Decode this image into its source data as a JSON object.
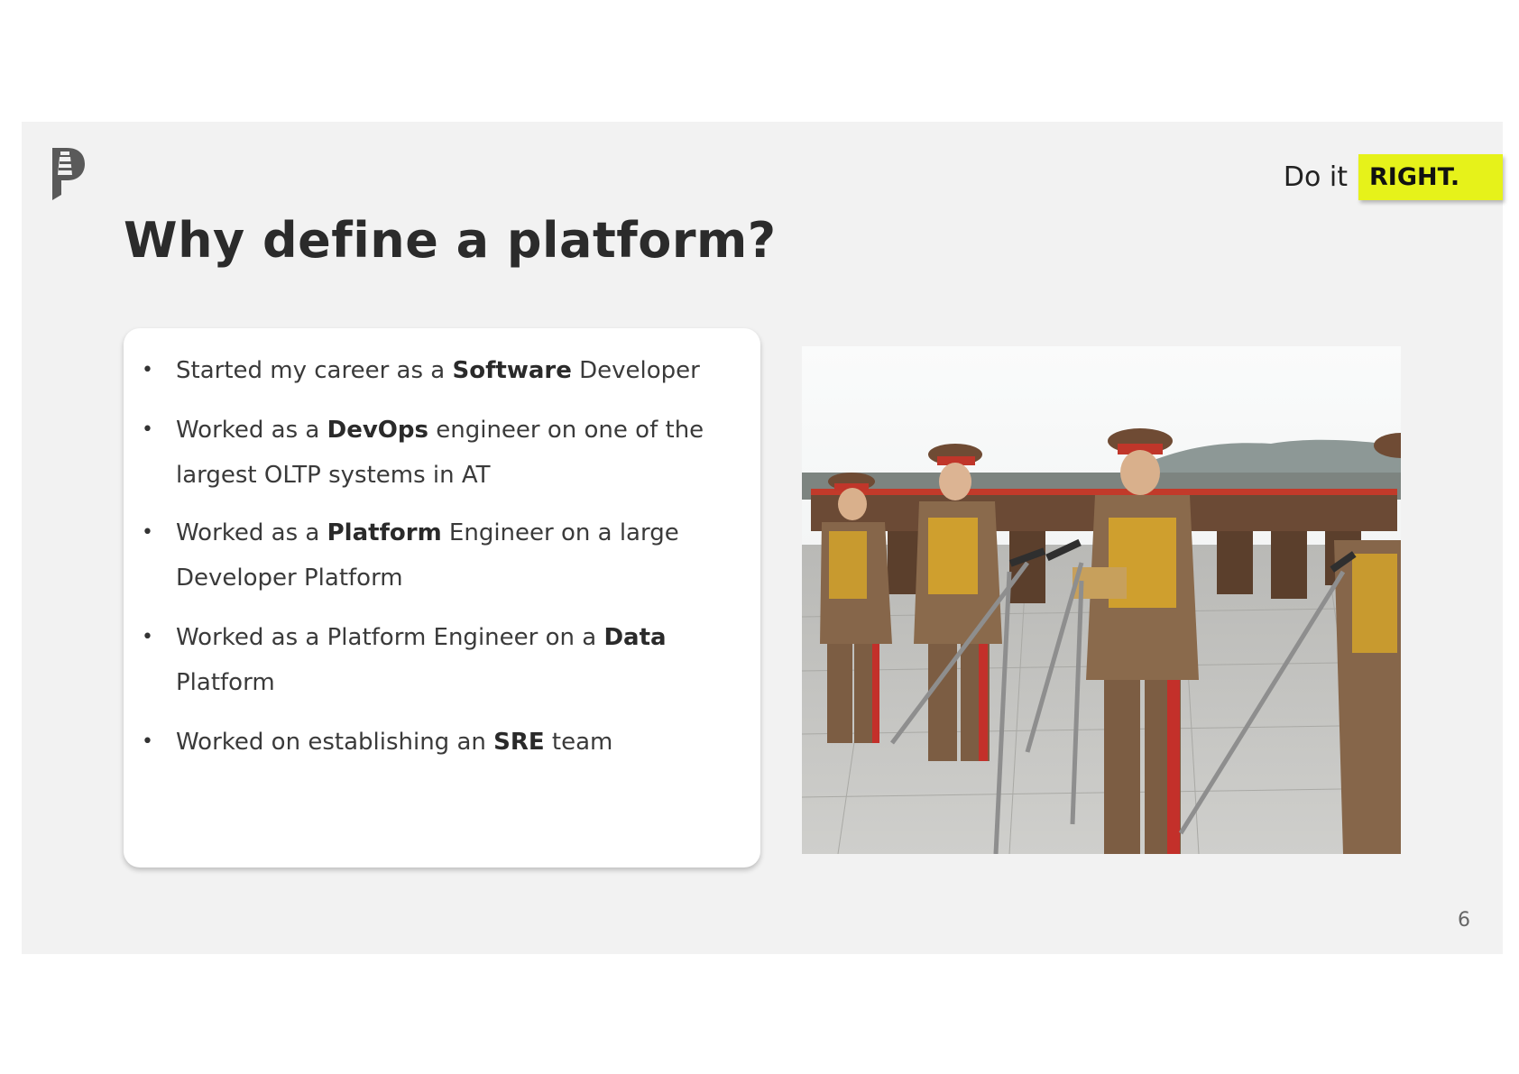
{
  "header": {
    "tagline_prefix": "Do it",
    "tagline_highlight": "RIGHT.",
    "logo_icon": "lighthouse-p-logo"
  },
  "title": "Why define a platform?",
  "bullets": [
    {
      "pre": "Started my career as a ",
      "bold": "Software",
      "post": " Developer"
    },
    {
      "pre": "Worked as a ",
      "bold": "DevOps",
      "post": " engineer on one of the largest OLTP systems in AT"
    },
    {
      "pre": "Worked as a ",
      "bold": "Platform",
      "post": " Engineer on a large Developer Platform"
    },
    {
      "pre": "Worked as a Platform Engineer on a ",
      "bold": "Data",
      "post": " Platform"
    },
    {
      "pre": "Worked on establishing an ",
      "bold": "SRE",
      "post": " team"
    }
  ],
  "image": {
    "subject": "photo-military-officers-at-microphones"
  },
  "page_number": "6",
  "colors": {
    "accent": "#e6f21a",
    "slide_background": "#f2f2f2",
    "title": "#2b2b2b"
  }
}
